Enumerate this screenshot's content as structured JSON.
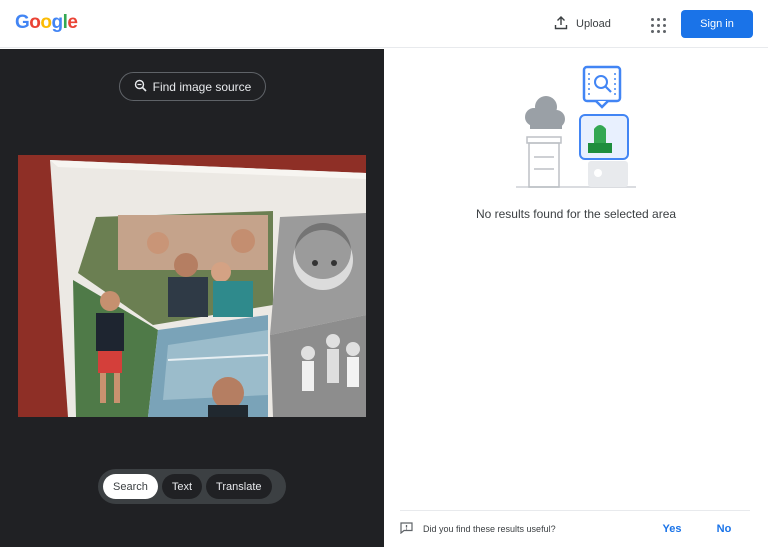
{
  "header": {
    "logo_letters": [
      {
        "ch": "G",
        "color": "#4285f4"
      },
      {
        "ch": "o",
        "color": "#ea4335"
      },
      {
        "ch": "o",
        "color": "#fbbc05"
      },
      {
        "ch": "g",
        "color": "#4285f4"
      },
      {
        "ch": "l",
        "color": "#34a853"
      },
      {
        "ch": "e",
        "color": "#ea4335"
      }
    ],
    "upload_label": "Upload",
    "apps_icon": "apps-grid-icon",
    "signin_label": "Sign in"
  },
  "viewer": {
    "find_source_label": "Find image source",
    "modes": [
      {
        "label": "Search",
        "active": true
      },
      {
        "label": "Text",
        "active": false
      },
      {
        "label": "Translate",
        "active": false
      }
    ]
  },
  "results": {
    "no_results_text": "No results found for the selected area",
    "feedback_question": "Did you find these results useful?",
    "yes_label": "Yes",
    "no_label": "No"
  },
  "colors": {
    "brand_blue": "#1a73e8",
    "dark_panel": "#202124",
    "accent_green": "#34a853"
  }
}
